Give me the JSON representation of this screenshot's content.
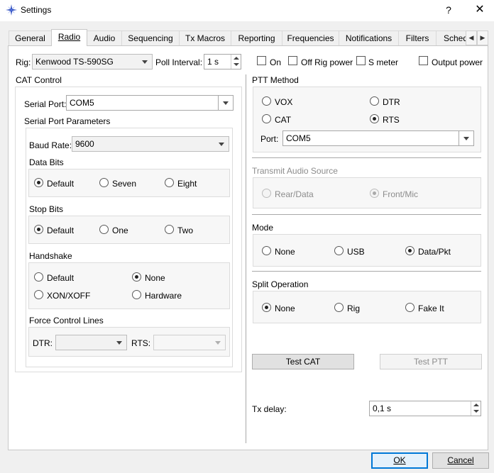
{
  "window": {
    "title": "Settings",
    "app_icon": "star-icon",
    "help_glyph": "?",
    "close_glyph": "✕"
  },
  "tabs": [
    "General",
    "Radio",
    "Audio",
    "Sequencing",
    "Tx Macros",
    "Reporting",
    "Frequencies",
    "Notifications",
    "Filters",
    "Schedu"
  ],
  "active_tab": "Radio",
  "top_row": {
    "rig_label": "Rig:",
    "rig_value": "Kenwood TS-590SG",
    "poll_label": "Poll Interval:",
    "poll_value": "1 s",
    "checks": [
      {
        "label": "On",
        "checked": false
      },
      {
        "label": "Off Rig power",
        "checked": false
      },
      {
        "label": "S meter",
        "checked": false
      },
      {
        "label": "Output power",
        "checked": false
      }
    ]
  },
  "cat": {
    "title": "CAT Control",
    "serial_port_label": "Serial Port:",
    "serial_port_value": "COM5",
    "params_title": "Serial Port Parameters",
    "baud_label": "Baud Rate:",
    "baud_value": "9600",
    "data_bits": {
      "title": "Data Bits",
      "options": [
        "Default",
        "Seven",
        "Eight"
      ],
      "selected": "Default"
    },
    "stop_bits": {
      "title": "Stop Bits",
      "options": [
        "Default",
        "One",
        "Two"
      ],
      "selected": "Default"
    },
    "handshake": {
      "title": "Handshake",
      "options": [
        "Default",
        "None",
        "XON/XOFF",
        "Hardware"
      ],
      "selected": "None"
    },
    "force_lines": {
      "title": "Force Control Lines",
      "dtr_label": "DTR:",
      "dtr_value": "",
      "rts_label": "RTS:",
      "rts_value": ""
    }
  },
  "ptt": {
    "title": "PTT Method",
    "options": [
      "VOX",
      "DTR",
      "CAT",
      "RTS"
    ],
    "selected": "RTS",
    "port_label": "Port:",
    "port_value": "COM5"
  },
  "audio_source": {
    "title": "Transmit Audio Source",
    "options": [
      "Rear/Data",
      "Front/Mic"
    ],
    "selected": "Front/Mic"
  },
  "mode": {
    "title": "Mode",
    "options": [
      "None",
      "USB",
      "Data/Pkt"
    ],
    "selected": "Data/Pkt"
  },
  "split": {
    "title": "Split Operation",
    "options": [
      "None",
      "Rig",
      "Fake It"
    ],
    "selected": "None"
  },
  "buttons": {
    "test_cat": "Test CAT",
    "test_ptt": "Test PTT",
    "ok": "OK",
    "cancel": "Cancel"
  },
  "tx_delay": {
    "label": "Tx delay:",
    "value": "0,1 s"
  }
}
